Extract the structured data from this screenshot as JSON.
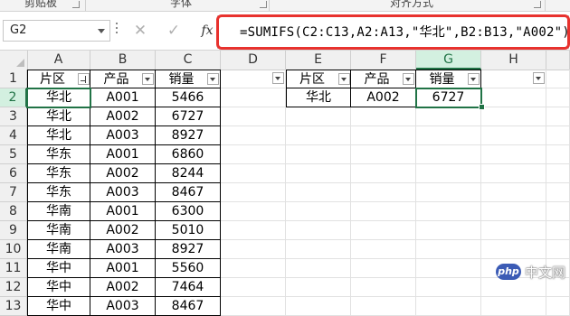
{
  "ribbon": {
    "groups": [
      "剪贴板",
      "字体",
      "对齐方式"
    ]
  },
  "formula_bar": {
    "name_box": "G2",
    "cancel_icon": "cancel-icon",
    "enter_icon": "check-icon",
    "fx_label": "fx",
    "formula": "=SUMIFS(C2:C13,A2:A13,\"华北\",B2:B13,\"A002\")",
    "highlight_color": "#e8322e"
  },
  "sheet": {
    "columns": [
      "A",
      "B",
      "C",
      "D",
      "E",
      "F",
      "G",
      "H"
    ],
    "active_cell": "G2",
    "rows": [
      "1",
      "2",
      "3",
      "4",
      "5",
      "6",
      "7",
      "8",
      "9",
      "10",
      "11",
      "12",
      "13"
    ],
    "source_table": {
      "headers": [
        "片区",
        "产品",
        "销量"
      ],
      "records": [
        [
          "华北",
          "A001",
          "5466"
        ],
        [
          "华北",
          "A002",
          "6727"
        ],
        [
          "华北",
          "A003",
          "8927"
        ],
        [
          "华东",
          "A001",
          "6860"
        ],
        [
          "华东",
          "A002",
          "8244"
        ],
        [
          "华东",
          "A003",
          "8467"
        ],
        [
          "华南",
          "A001",
          "6300"
        ],
        [
          "华南",
          "A002",
          "5010"
        ],
        [
          "华南",
          "A003",
          "8927"
        ],
        [
          "华中",
          "A001",
          "5560"
        ],
        [
          "华中",
          "A002",
          "7464"
        ],
        [
          "华中",
          "A003",
          "8467"
        ]
      ]
    },
    "criteria_table": {
      "headers": [
        "片区",
        "产品",
        "销量"
      ],
      "values": [
        "华北",
        "A002",
        "6727"
      ]
    }
  },
  "watermark": {
    "logo": "php",
    "text": "中文网"
  },
  "colors": {
    "excel_green": "#217346",
    "selection_header_bg": "#d3f0e0"
  }
}
